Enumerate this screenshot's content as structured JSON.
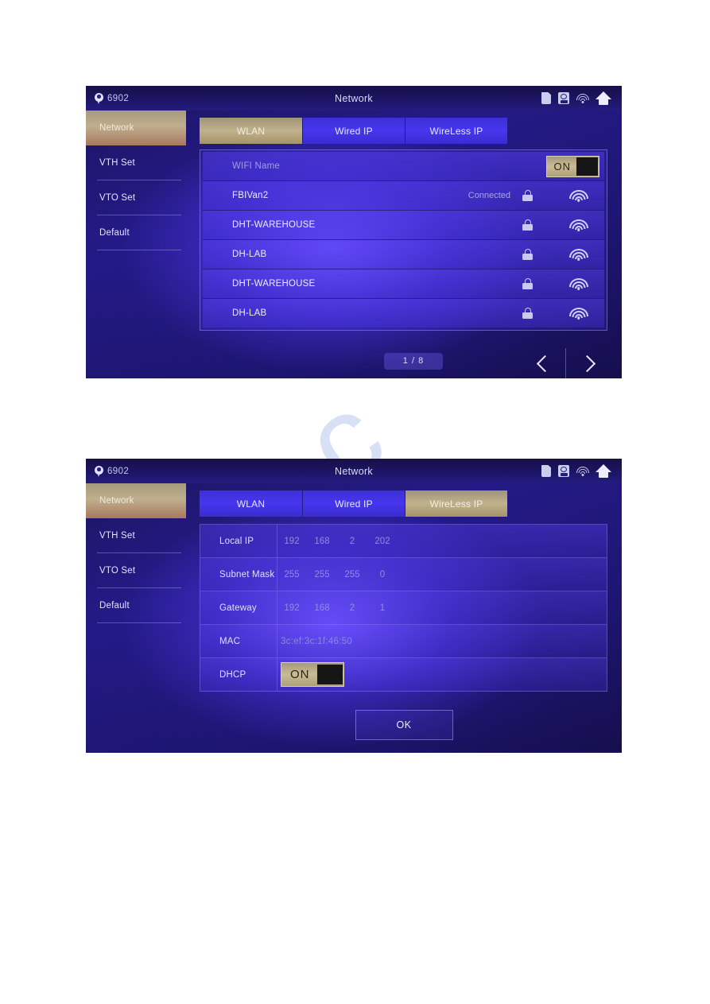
{
  "watermark": {
    "text": "ve.c"
  },
  "panels": [
    {
      "id": "wlan-screen",
      "statusbar": {
        "device_id": "6902",
        "title": "Network",
        "icons": [
          "sd-card-icon",
          "alarm-icon",
          "wifi-icon",
          "home-icon"
        ]
      },
      "sidebar": {
        "items": [
          {
            "label": "Network",
            "selected": true
          },
          {
            "label": "VTH Set",
            "selected": false
          },
          {
            "label": "VTO Set",
            "selected": false
          },
          {
            "label": "Default",
            "selected": false
          }
        ]
      },
      "tabs": [
        {
          "label": "WLAN",
          "active": true
        },
        {
          "label": "Wired IP",
          "active": false
        },
        {
          "label": "WireLess IP",
          "active": false
        }
      ],
      "wifi": {
        "header_label": "WIFI Name",
        "toggle": {
          "label": "ON",
          "state": "on"
        },
        "networks": [
          {
            "ssid": "FBIVan2",
            "status": "Connected",
            "secured": true,
            "signal": 4
          },
          {
            "ssid": "DHT-WAREHOUSE",
            "status": "",
            "secured": true,
            "signal": 4
          },
          {
            "ssid": "DH-LAB",
            "status": "",
            "secured": true,
            "signal": 4
          },
          {
            "ssid": "DHT-WAREHOUSE",
            "status": "",
            "secured": true,
            "signal": 4
          },
          {
            "ssid": "DH-LAB",
            "status": "",
            "secured": true,
            "signal": 4
          }
        ]
      },
      "pagination": {
        "text": "1 / 8",
        "prev": "previous-page",
        "next": "next-page"
      }
    },
    {
      "id": "wired-ip-screen",
      "statusbar": {
        "device_id": "6902",
        "title": "Network",
        "icons": [
          "sd-card-icon",
          "alarm-icon",
          "wifi-icon",
          "home-icon"
        ]
      },
      "sidebar": {
        "items": [
          {
            "label": "Network",
            "selected": true
          },
          {
            "label": "VTH Set",
            "selected": false
          },
          {
            "label": "VTO Set",
            "selected": false
          },
          {
            "label": "Default",
            "selected": false
          }
        ]
      },
      "tabs": [
        {
          "label": "WLAN",
          "active": false
        },
        {
          "label": "Wired IP",
          "active": false
        },
        {
          "label": "WireLess IP",
          "active": true
        }
      ],
      "form": {
        "local_ip": {
          "label": "Local IP",
          "octets": [
            "192",
            "168",
            "2",
            "202"
          ]
        },
        "subnet_mask": {
          "label": "Subnet Mask",
          "octets": [
            "255",
            "255",
            "255",
            "0"
          ]
        },
        "gateway": {
          "label": "Gateway",
          "octets": [
            "192",
            "168",
            "2",
            "1"
          ]
        },
        "mac": {
          "label": "MAC",
          "value": "3c:ef:3c:1f:46:50"
        },
        "dhcp": {
          "label": "DHCP",
          "toggle": {
            "label": "ON",
            "state": "on"
          }
        },
        "ok_button": "OK"
      }
    }
  ],
  "colors": {
    "accent_gold": "#bfae8c",
    "panel_blue": "#4636ef",
    "status_bar": "#1d1566",
    "text_light": "#eceeff"
  }
}
